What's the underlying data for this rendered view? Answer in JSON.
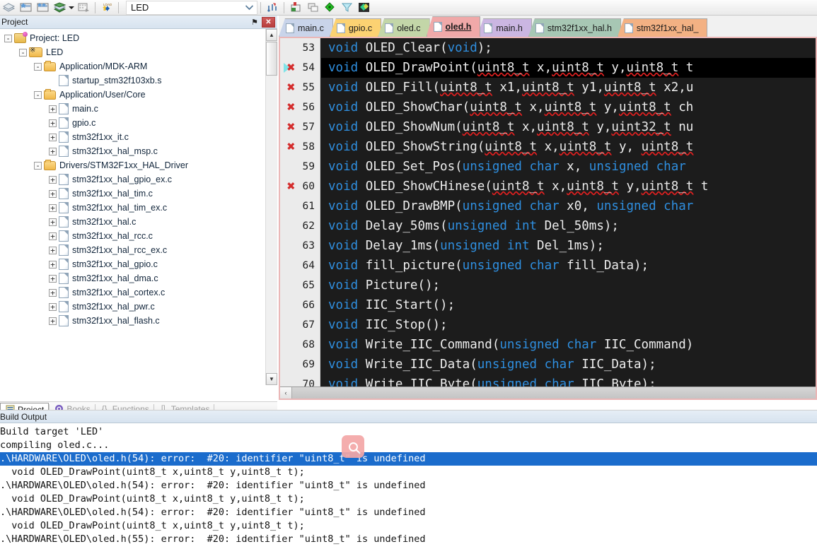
{
  "toolbar": {
    "icons": [
      "build-icon",
      "rebuild-icon",
      "batch-build-icon",
      "download-icon",
      "dropdown-arrow-icon",
      "manage-project-items-icon",
      "load-icon",
      "target-options-icon",
      "new-window-icon",
      "debug-icon",
      "configuration-wizard-icon",
      "packs-icon"
    ],
    "target_select": {
      "value": "LED",
      "arrow": "chevron-down-icon"
    }
  },
  "project_panel": {
    "title": "Project",
    "pin_label": "⚑",
    "close_label": "✕",
    "tree": [
      {
        "indent": 0,
        "expander": "-",
        "icon": "project-icon",
        "label": "Project: LED"
      },
      {
        "indent": 1,
        "expander": "-",
        "icon": "target-group-icon",
        "label": "LED"
      },
      {
        "indent": 2,
        "expander": "-",
        "icon": "folder-icon",
        "label": "Application/MDK-ARM"
      },
      {
        "indent": 3,
        "expander": "",
        "icon": "file-icon",
        "label": "startup_stm32f103xb.s"
      },
      {
        "indent": 2,
        "expander": "-",
        "icon": "folder-icon",
        "label": "Application/User/Core"
      },
      {
        "indent": 3,
        "expander": "+",
        "icon": "file-icon",
        "label": "main.c"
      },
      {
        "indent": 3,
        "expander": "+",
        "icon": "file-icon",
        "label": "gpio.c"
      },
      {
        "indent": 3,
        "expander": "+",
        "icon": "file-icon",
        "label": "stm32f1xx_it.c"
      },
      {
        "indent": 3,
        "expander": "+",
        "icon": "file-icon",
        "label": "stm32f1xx_hal_msp.c"
      },
      {
        "indent": 2,
        "expander": "-",
        "icon": "folder-icon",
        "label": "Drivers/STM32F1xx_HAL_Driver"
      },
      {
        "indent": 3,
        "expander": "+",
        "icon": "file-icon",
        "label": "stm32f1xx_hal_gpio_ex.c"
      },
      {
        "indent": 3,
        "expander": "+",
        "icon": "file-icon",
        "label": "stm32f1xx_hal_tim.c"
      },
      {
        "indent": 3,
        "expander": "+",
        "icon": "file-icon",
        "label": "stm32f1xx_hal_tim_ex.c"
      },
      {
        "indent": 3,
        "expander": "+",
        "icon": "file-icon",
        "label": "stm32f1xx_hal.c"
      },
      {
        "indent": 3,
        "expander": "+",
        "icon": "file-icon",
        "label": "stm32f1xx_hal_rcc.c"
      },
      {
        "indent": 3,
        "expander": "+",
        "icon": "file-icon",
        "label": "stm32f1xx_hal_rcc_ex.c"
      },
      {
        "indent": 3,
        "expander": "+",
        "icon": "file-icon",
        "label": "stm32f1xx_hal_gpio.c"
      },
      {
        "indent": 3,
        "expander": "+",
        "icon": "file-icon",
        "label": "stm32f1xx_hal_dma.c"
      },
      {
        "indent": 3,
        "expander": "+",
        "icon": "file-icon",
        "label": "stm32f1xx_hal_cortex.c"
      },
      {
        "indent": 3,
        "expander": "+",
        "icon": "file-icon",
        "label": "stm32f1xx_hal_pwr.c"
      },
      {
        "indent": 3,
        "expander": "+",
        "icon": "file-icon",
        "label": "stm32f1xx_hal_flash.c"
      }
    ],
    "tabs": [
      {
        "label": "Project",
        "icon": "project-tab-icon",
        "active": true
      },
      {
        "label": "Books",
        "icon": "books-icon",
        "active": false
      },
      {
        "label": "Functions",
        "icon": "braces-icon",
        "active": false
      },
      {
        "label": "Templates",
        "icon": "templates-icon",
        "active": false
      }
    ]
  },
  "editor": {
    "tabs": [
      {
        "label": "main.c",
        "color": "#c9d4ea",
        "active": false
      },
      {
        "label": "gpio.c",
        "color": "#fcd272",
        "active": false
      },
      {
        "label": "oled.c",
        "color": "#c3d6a8",
        "active": false
      },
      {
        "label": "oled.h",
        "color": "#f0a9a9",
        "active": true
      },
      {
        "label": "main.h",
        "color": "#cbb6e2",
        "active": false
      },
      {
        "label": "stm32f1xx_hal.h",
        "color": "#a7c7b4",
        "active": false
      },
      {
        "label": "stm32f1xx_hal_",
        "color": "#f3b183",
        "active": false
      }
    ],
    "lines": [
      {
        "num": 53,
        "error": false,
        "current": false,
        "selected": false,
        "tokens": [
          {
            "t": "void",
            "c": "kw"
          },
          {
            "t": " OLED_Clear",
            "c": "id"
          },
          {
            "t": "(",
            "c": "id"
          },
          {
            "t": "void",
            "c": "kw"
          },
          {
            "t": ");",
            "c": "id"
          }
        ]
      },
      {
        "num": 54,
        "error": true,
        "current": true,
        "selected": true,
        "tokens": [
          {
            "t": "void",
            "c": "kw"
          },
          {
            "t": " OLED_DrawPoint",
            "c": "id"
          },
          {
            "t": "(",
            "c": "id"
          },
          {
            "t": "uint8_t",
            "c": "sq"
          },
          {
            "t": " x,",
            "c": "id"
          },
          {
            "t": "uint8_t",
            "c": "sq"
          },
          {
            "t": " y,",
            "c": "id"
          },
          {
            "t": "uint8_t",
            "c": "sq"
          },
          {
            "t": " t",
            "c": "id"
          }
        ]
      },
      {
        "num": 55,
        "error": true,
        "current": false,
        "selected": false,
        "tokens": [
          {
            "t": "void",
            "c": "kw"
          },
          {
            "t": " OLED_Fill",
            "c": "id"
          },
          {
            "t": "(",
            "c": "id"
          },
          {
            "t": "uint8_t",
            "c": "sq"
          },
          {
            "t": " x1,",
            "c": "id"
          },
          {
            "t": "uint8_t",
            "c": "sq"
          },
          {
            "t": " y1,",
            "c": "id"
          },
          {
            "t": "uint8_t",
            "c": "sq"
          },
          {
            "t": " x2,u",
            "c": "id"
          }
        ]
      },
      {
        "num": 56,
        "error": true,
        "current": false,
        "selected": false,
        "tokens": [
          {
            "t": "void",
            "c": "kw"
          },
          {
            "t": " OLED_ShowChar",
            "c": "id"
          },
          {
            "t": "(",
            "c": "id"
          },
          {
            "t": "uint8_t",
            "c": "sq"
          },
          {
            "t": " x,",
            "c": "id"
          },
          {
            "t": "uint8_t",
            "c": "sq"
          },
          {
            "t": " y,",
            "c": "id"
          },
          {
            "t": "uint8_t",
            "c": "sq"
          },
          {
            "t": " ch",
            "c": "id"
          }
        ]
      },
      {
        "num": 57,
        "error": true,
        "current": false,
        "selected": false,
        "tokens": [
          {
            "t": "void",
            "c": "kw"
          },
          {
            "t": " OLED_ShowNum",
            "c": "id"
          },
          {
            "t": "(",
            "c": "id"
          },
          {
            "t": "uint8_t",
            "c": "sq"
          },
          {
            "t": " x,",
            "c": "id"
          },
          {
            "t": "uint8_t",
            "c": "sq"
          },
          {
            "t": " y,",
            "c": "id"
          },
          {
            "t": "uint32_t",
            "c": "sq"
          },
          {
            "t": " nu",
            "c": "id"
          }
        ]
      },
      {
        "num": 58,
        "error": true,
        "current": false,
        "selected": false,
        "tokens": [
          {
            "t": "void",
            "c": "kw"
          },
          {
            "t": " OLED_ShowString",
            "c": "id"
          },
          {
            "t": "(",
            "c": "id"
          },
          {
            "t": "uint8_t",
            "c": "sq"
          },
          {
            "t": " x,",
            "c": "id"
          },
          {
            "t": "uint8_t",
            "c": "sq"
          },
          {
            "t": " y, ",
            "c": "id"
          },
          {
            "t": "uint8_t",
            "c": "sq"
          },
          {
            "t": "",
            "c": "id"
          }
        ]
      },
      {
        "num": 59,
        "error": false,
        "current": false,
        "selected": false,
        "tokens": [
          {
            "t": "void",
            "c": "kw"
          },
          {
            "t": " OLED_Set_Pos",
            "c": "id"
          },
          {
            "t": "(",
            "c": "id"
          },
          {
            "t": "unsigned char",
            "c": "kw"
          },
          {
            "t": " x, ",
            "c": "id"
          },
          {
            "t": "unsigned char",
            "c": "kw"
          },
          {
            "t": " ",
            "c": "id"
          }
        ]
      },
      {
        "num": 60,
        "error": true,
        "current": false,
        "selected": false,
        "tokens": [
          {
            "t": "void",
            "c": "kw"
          },
          {
            "t": " OLED_ShowCHinese",
            "c": "id"
          },
          {
            "t": "(",
            "c": "id"
          },
          {
            "t": "uint8_t",
            "c": "sq"
          },
          {
            "t": " x,",
            "c": "id"
          },
          {
            "t": "uint8_t",
            "c": "sq"
          },
          {
            "t": " y,",
            "c": "id"
          },
          {
            "t": "uint8_t",
            "c": "sq"
          },
          {
            "t": " t",
            "c": "id"
          }
        ]
      },
      {
        "num": 61,
        "error": false,
        "current": false,
        "selected": false,
        "tokens": [
          {
            "t": "void",
            "c": "kw"
          },
          {
            "t": " OLED_DrawBMP",
            "c": "id"
          },
          {
            "t": "(",
            "c": "id"
          },
          {
            "t": "unsigned char",
            "c": "kw"
          },
          {
            "t": " x0, ",
            "c": "id"
          },
          {
            "t": "unsigned char",
            "c": "kw"
          },
          {
            "t": "",
            "c": "id"
          }
        ]
      },
      {
        "num": 62,
        "error": false,
        "current": false,
        "selected": false,
        "tokens": [
          {
            "t": "void",
            "c": "kw"
          },
          {
            "t": " Delay_50ms",
            "c": "id"
          },
          {
            "t": "(",
            "c": "id"
          },
          {
            "t": "unsigned int",
            "c": "kw"
          },
          {
            "t": " Del_50ms);",
            "c": "id"
          }
        ]
      },
      {
        "num": 63,
        "error": false,
        "current": false,
        "selected": false,
        "tokens": [
          {
            "t": "void",
            "c": "kw"
          },
          {
            "t": " Delay_1ms",
            "c": "id"
          },
          {
            "t": "(",
            "c": "id"
          },
          {
            "t": "unsigned int",
            "c": "kw"
          },
          {
            "t": " Del_1ms);",
            "c": "id"
          }
        ]
      },
      {
        "num": 64,
        "error": false,
        "current": false,
        "selected": false,
        "tokens": [
          {
            "t": "void",
            "c": "kw"
          },
          {
            "t": " fill_picture",
            "c": "id"
          },
          {
            "t": "(",
            "c": "id"
          },
          {
            "t": "unsigned char",
            "c": "kw"
          },
          {
            "t": " fill_Data);",
            "c": "id"
          }
        ]
      },
      {
        "num": 65,
        "error": false,
        "current": false,
        "selected": false,
        "tokens": [
          {
            "t": "void",
            "c": "kw"
          },
          {
            "t": " Picture();",
            "c": "id"
          }
        ]
      },
      {
        "num": 66,
        "error": false,
        "current": false,
        "selected": false,
        "tokens": [
          {
            "t": "void",
            "c": "kw"
          },
          {
            "t": " IIC_Start();",
            "c": "id"
          }
        ]
      },
      {
        "num": 67,
        "error": false,
        "current": false,
        "selected": false,
        "tokens": [
          {
            "t": "void",
            "c": "kw"
          },
          {
            "t": " IIC_Stop();",
            "c": "id"
          }
        ]
      },
      {
        "num": 68,
        "error": false,
        "current": false,
        "selected": false,
        "tokens": [
          {
            "t": "void",
            "c": "kw"
          },
          {
            "t": " Write_IIC_Command",
            "c": "id"
          },
          {
            "t": "(",
            "c": "id"
          },
          {
            "t": "unsigned char",
            "c": "kw"
          },
          {
            "t": " IIC_Command)",
            "c": "id"
          }
        ]
      },
      {
        "num": 69,
        "error": false,
        "current": false,
        "selected": false,
        "tokens": [
          {
            "t": "void",
            "c": "kw"
          },
          {
            "t": " Write_IIC_Data",
            "c": "id"
          },
          {
            "t": "(",
            "c": "id"
          },
          {
            "t": "unsigned char",
            "c": "kw"
          },
          {
            "t": " IIC_Data);",
            "c": "id"
          }
        ]
      },
      {
        "num": 70,
        "error": false,
        "current": false,
        "selected": false,
        "tokens": [
          {
            "t": "void",
            "c": "kw"
          },
          {
            "t": " Write_IIC_Byte",
            "c": "id"
          },
          {
            "t": "(",
            "c": "id"
          },
          {
            "t": "unsigned char",
            "c": "kw"
          },
          {
            "t": " IIC_Byte);",
            "c": "id"
          }
        ]
      }
    ],
    "hscroll_left_arrow": "‹"
  },
  "build_output": {
    "title": "Build Output",
    "lines": [
      {
        "text": "Build target 'LED'",
        "selected": false
      },
      {
        "text": "compiling oled.c...",
        "selected": false
      },
      {
        "text": ".\\HARDWARE\\OLED\\oled.h(54): error:  #20: identifier \"uint8_t\" is undefined",
        "selected": true
      },
      {
        "text": "  void OLED_DrawPoint(uint8_t x,uint8_t y,uint8_t t);",
        "selected": false
      },
      {
        "text": ".\\HARDWARE\\OLED\\oled.h(54): error:  #20: identifier \"uint8_t\" is undefined",
        "selected": false
      },
      {
        "text": "  void OLED_DrawPoint(uint8_t x,uint8_t y,uint8_t t);",
        "selected": false
      },
      {
        "text": ".\\HARDWARE\\OLED\\oled.h(54): error:  #20: identifier \"uint8_t\" is undefined",
        "selected": false
      },
      {
        "text": "  void OLED_DrawPoint(uint8_t x,uint8_t y,uint8_t t);",
        "selected": false
      },
      {
        "text": ".\\HARDWARE\\OLED\\oled.h(55): error:  #20: identifier \"uint8_t\" is undefined",
        "selected": false
      }
    ]
  },
  "overlay": {
    "search_icon": "search-icon"
  },
  "colors": {
    "editor_bg": "#1c1c1c",
    "keyword": "#2f8fe0",
    "identifier": "#eeeeee",
    "error_marker": "#d42c2c",
    "selection": "#1b6ccc",
    "panel_border": "#eab6b6"
  }
}
